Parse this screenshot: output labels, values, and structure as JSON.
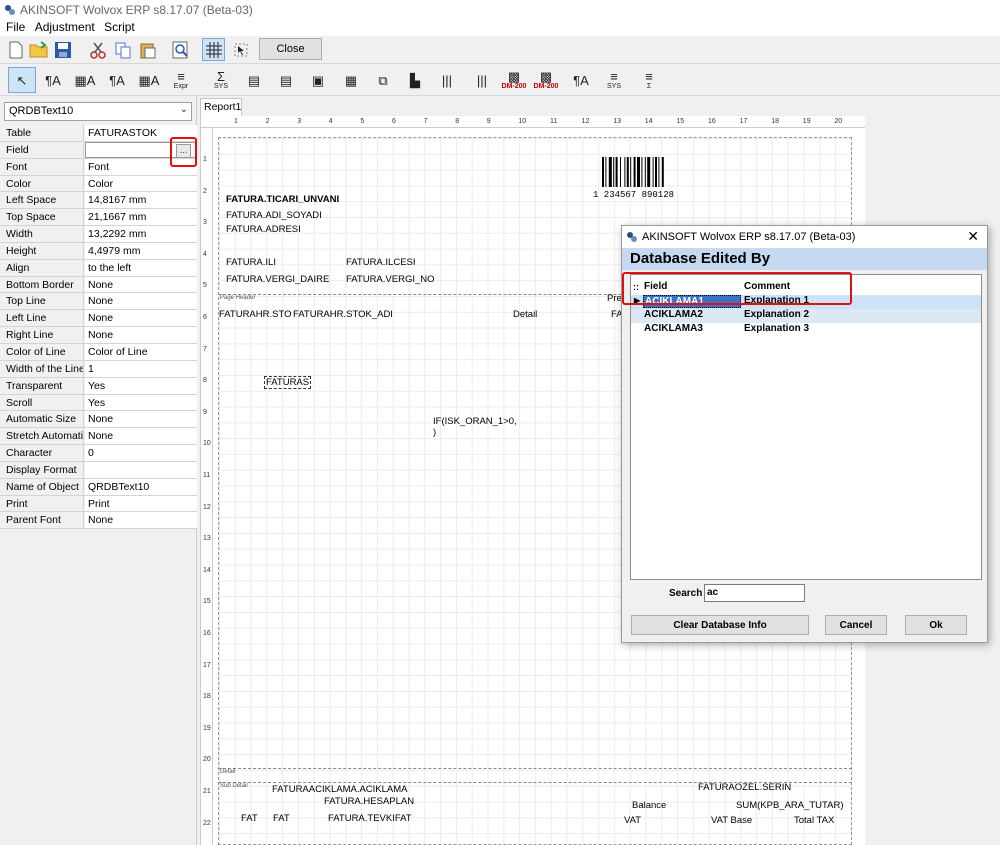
{
  "app": {
    "title": "AKINSOFT Wolvox ERP s8.17.07 (Beta-03)"
  },
  "menu": [
    "File",
    "Adjustment",
    "Script"
  ],
  "toolbar1": {
    "close_label": "Close"
  },
  "toolbar2": {
    "items": [
      {
        "glyph": "↖",
        "sub": ""
      },
      {
        "glyph": "¶A",
        "sub": ""
      },
      {
        "glyph": "▦A",
        "sub": ""
      },
      {
        "glyph": "¶A",
        "sub": ""
      },
      {
        "glyph": "▦A",
        "sub": ""
      },
      {
        "glyph": "≡",
        "sub": "Expr"
      },
      {
        "glyph": "Σ",
        "sub": "SYS"
      },
      {
        "glyph": "▤",
        "sub": ""
      },
      {
        "glyph": "▤",
        "sub": ""
      },
      {
        "glyph": "▣",
        "sub": ""
      },
      {
        "glyph": "▦",
        "sub": ""
      },
      {
        "glyph": "⧉",
        "sub": ""
      },
      {
        "glyph": "▙",
        "sub": ""
      },
      {
        "glyph": "|||",
        "sub": ""
      },
      {
        "glyph": "|||",
        "sub": ""
      },
      {
        "glyph": "▩",
        "sub": "DM-200"
      },
      {
        "glyph": "▩",
        "sub": "DM-200"
      },
      {
        "glyph": "¶A",
        "sub": ""
      },
      {
        "glyph": "≡",
        "sub": "SYS"
      },
      {
        "glyph": "≡",
        "sub": "Σ"
      }
    ]
  },
  "left_panel": {
    "object_select": "QRDBText10",
    "properties": [
      {
        "key": "Table",
        "value": "FATURASTOK"
      },
      {
        "key": "Field",
        "value": ""
      },
      {
        "key": "Font",
        "value": "Font"
      },
      {
        "key": "Color",
        "value": "Color"
      },
      {
        "key": "Left Space",
        "value": "14,8167 mm"
      },
      {
        "key": "Top Space",
        "value": "21,1667 mm"
      },
      {
        "key": "Width",
        "value": "13,2292 mm"
      },
      {
        "key": "Height",
        "value": "4,4979 mm"
      },
      {
        "key": "Align",
        "value": "to the left"
      },
      {
        "key": "Bottom Border",
        "value": "None"
      },
      {
        "key": "Top Line",
        "value": "None"
      },
      {
        "key": "Left Line",
        "value": "None"
      },
      {
        "key": "Right Line",
        "value": "None"
      },
      {
        "key": "Color of Line",
        "value": "Color of Line"
      },
      {
        "key": "Width of the Line",
        "value": "1"
      },
      {
        "key": "Transparent",
        "value": "Yes"
      },
      {
        "key": "Scroll",
        "value": "Yes"
      },
      {
        "key": "Automatic Size",
        "value": "None"
      },
      {
        "key": "Stretch Automatically",
        "value": "None"
      },
      {
        "key": "Character",
        "value": "0"
      },
      {
        "key": "Display Format",
        "value": ""
      },
      {
        "key": "Name of Object",
        "value": "QRDBText10"
      },
      {
        "key": "Print",
        "value": "Print"
      },
      {
        "key": "Parent Font",
        "value": "None"
      }
    ]
  },
  "tabs": [
    "Report1"
  ],
  "report": {
    "ruler_top": [
      "1",
      "2",
      "3",
      "4",
      "5",
      "6",
      "7",
      "8",
      "9",
      "10",
      "11",
      "12",
      "13",
      "14",
      "15",
      "16",
      "17",
      "18",
      "19",
      "20"
    ],
    "ruler_left": [
      "1",
      "2",
      "3",
      "4",
      "5",
      "6",
      "7",
      "8",
      "9",
      "10",
      "11",
      "12",
      "13",
      "14",
      "15",
      "16",
      "17",
      "18",
      "19",
      "20",
      "21",
      "22"
    ],
    "bands": {
      "page_header": "Page Header",
      "detail": "Detail",
      "sub_detail": "Sub Detail"
    },
    "barcode_text": "1  234567  890128",
    "fields": {
      "ticari_unvani": "FATURA.TICARI_UNVANI",
      "adi_soyadi": "FATURA.ADI_SOYADI",
      "adresi": "FATURA.ADRESI",
      "ili": "FATURA.ILI",
      "ilcesi": "FATURA.ILCESI",
      "vergi_daire": "FATURA.VERGI_DAIRE",
      "vergi_no": "FATURA.VERGI_NO",
      "prev": "Prev",
      "faturahr_sto": "FATURAHR.STO",
      "faturahr_stok_adi": "FATURAHR.STOK_ADI",
      "detail": "Detail",
      "fa": "FA",
      "faturas": "FATURAS",
      "if_isk": "IF(ISK_ORAN_1>0,",
      "if_isk2": ")",
      "aciklama": "FATURAACIKLAMA.ACIKLAMA",
      "ozel_serin": "FATURAOZEL.SERIN",
      "hesaplan": "FATURA.HESAPLAN",
      "balance": "Balance",
      "sum_kpb": "SUM(KPB_ARA_TUTAR)",
      "fat1": "FAT",
      "fat2": "FAT",
      "tevkifat": "FATURA.TEVKIFAT",
      "vat": "VAT",
      "vat_base": "VAT Base",
      "total_tax": "Total TAX"
    }
  },
  "dialog": {
    "title": "AKINSOFT Wolvox ERP s8.17.07 (Beta-03)",
    "header": "Database Edited By",
    "columns": {
      "field": "Field",
      "comment": "Comment"
    },
    "rows": [
      {
        "field": "ACIKLAMA1",
        "comment": "Explanation 1"
      },
      {
        "field": "ACIKLAMA2",
        "comment": "Explanation 2"
      },
      {
        "field": "ACIKLAMA3",
        "comment": "Explanation 3"
      }
    ],
    "search_label": "Search",
    "search_value": "ac",
    "clear_button": "Clear Database Info",
    "cancel_button": "Cancel",
    "ok_button": "Ok"
  }
}
